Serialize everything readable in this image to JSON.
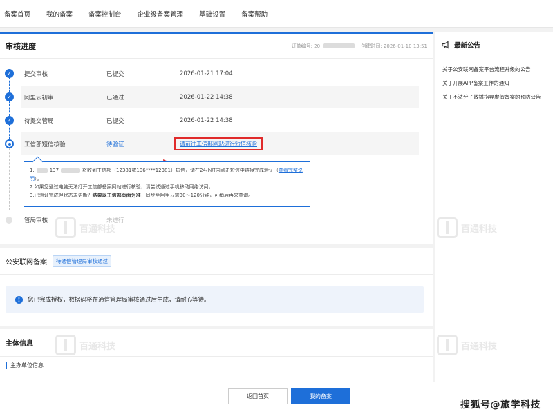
{
  "nav": {
    "items": [
      "备案首页",
      "我的备案",
      "备案控制台",
      "企业级备案管理",
      "基础设置",
      "备案帮助"
    ]
  },
  "progress": {
    "title": "审核进度",
    "order_label": "订单编号: 20",
    "created_label": "创建时间: 2026-01-10 13:51",
    "steps": [
      {
        "name": "提交审核",
        "status": "已提交",
        "time": "2026-01-21 17:04"
      },
      {
        "name": "阿里云初审",
        "status": "已通过",
        "time": "2026-01-22 14:38"
      },
      {
        "name": "待提交管局",
        "status": "已提交",
        "time": "2026-01-22 14:38"
      },
      {
        "name": "工信部短信核验",
        "status": "待验证",
        "time": "请前往工信部网站进行短信核验"
      },
      {
        "name": "管局审核",
        "status": "未进行",
        "time": ""
      }
    ],
    "notice": {
      "line1_prefix": "1.",
      "line1_phone": "137",
      "line1_text": "将收到工信部（12381或106****12381）短信，请在24小时内点击短信中链接完成验证（",
      "line1_link": "查看完整说明",
      "line1_end": "）。",
      "line2": "2.如果您通过电脑无法打开工信部备案网站进行核验，请尝试通过手机移动网络访问。",
      "line3_prefix": "3.已验证完成但状态未更新？",
      "line3_bold": "结果以工信部页面为准",
      "line3_suffix": "，同步至阿里云需30～120分钟，可稍后再来查询。"
    }
  },
  "police": {
    "title": "公安联网备案",
    "tag": "待通信管理局审核通过",
    "info": "您已完成授权，数据码将在通信管理局审核通过后生成，请耐心等待。"
  },
  "subject": {
    "title": "主体信息",
    "section": "主办单位信息"
  },
  "sidebar": {
    "title": "最新公告",
    "items": [
      "关于公安联网备案平台流程升级的公告",
      "关于开展APP备案工作的通知",
      "关于不法分子散播指导虚假备案的预防公告"
    ]
  },
  "footer": {
    "back_label": "返回首页",
    "mine_label": "我的备案",
    "watermark": "搜狐号@旅学科技"
  },
  "watermark": {
    "name": "百通科技"
  }
}
